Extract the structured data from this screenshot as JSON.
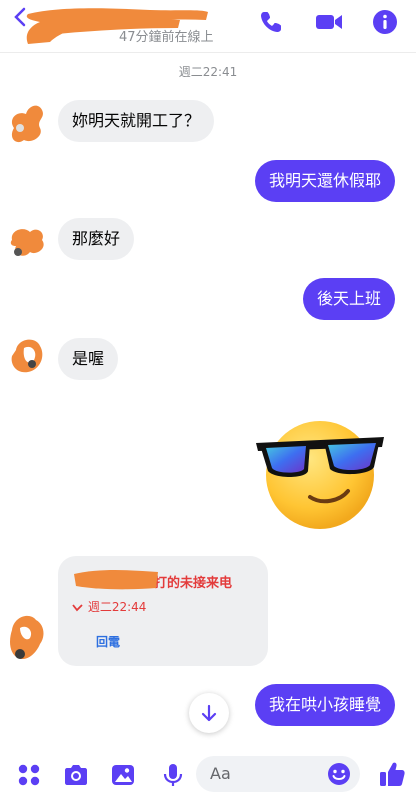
{
  "colors": {
    "accent": "#5b3ff4",
    "incoming_bubble": "#eeeff1",
    "missed_call": "#e33b3b",
    "link_blue": "#2d6fe0",
    "redaction_orange": "#f08a3c"
  },
  "header": {
    "status": "47分鐘前在線上",
    "icons": [
      "back-arrow-icon",
      "phone-icon",
      "video-camera-icon",
      "info-icon"
    ]
  },
  "conversation": {
    "timestamp": "週二22:41",
    "messages": [
      {
        "side": "in",
        "text": "妳明天就開工了？"
      },
      {
        "side": "out",
        "text": "我明天還休假耶"
      },
      {
        "side": "in",
        "text": "那麼好"
      },
      {
        "side": "out",
        "text": "後天上班"
      },
      {
        "side": "in",
        "text": "是喔"
      },
      {
        "side": "out",
        "type": "emoji",
        "emoji": "sunglasses-face"
      },
      {
        "side": "in",
        "type": "missed-call"
      },
      {
        "side": "out",
        "text": "我在哄小孩睡覺"
      }
    ],
    "missed_call": {
      "title": "打的未接来电",
      "time": "週二22:44",
      "call_back": "回電"
    }
  },
  "composer": {
    "placeholder": "Aa",
    "icons": [
      "apps-grid-icon",
      "camera-icon",
      "image-icon",
      "microphone-icon",
      "emoji-icon",
      "thumbs-up-icon"
    ]
  }
}
